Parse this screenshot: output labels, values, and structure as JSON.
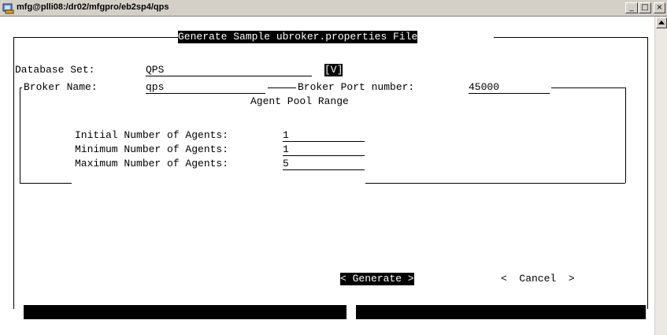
{
  "window": {
    "title": "mfg@plli08:/dr02/mfgpro/eb2sp4/qps",
    "minimize_label": "_",
    "maximize_label": "□",
    "close_label": "×"
  },
  "form": {
    "title": "Generate Sample ubroker.properties File",
    "database_set": {
      "label": "Database Set:",
      "value": "QPS",
      "lookup": "[V]"
    },
    "broker_name": {
      "label": "Broker Name:",
      "value": "qps"
    },
    "broker_port": {
      "label": "Broker Port number:",
      "value": "45000"
    },
    "agent_pool": {
      "title": "Agent Pool Range",
      "initial": {
        "label": "Initial Number of Agents:",
        "value": "1"
      },
      "minimum": {
        "label": "Minimum Number of Agents:",
        "value": "1"
      },
      "maximum": {
        "label": "Maximum Number of Agents:",
        "value": "5"
      }
    },
    "buttons": {
      "generate": "< Generate >",
      "cancel": "<  Cancel  >"
    }
  }
}
